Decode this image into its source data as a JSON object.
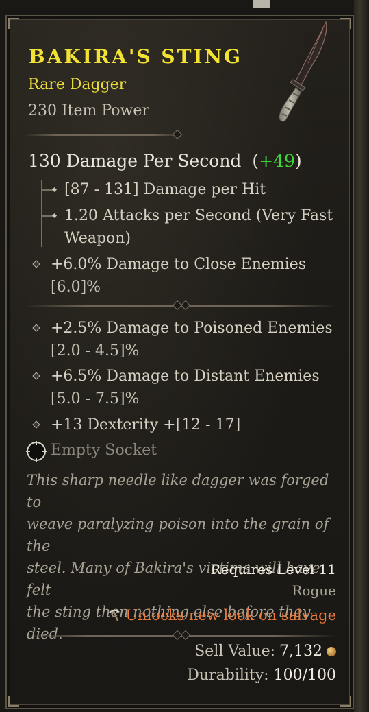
{
  "item": {
    "name": "BAKIRA'S STING",
    "rarity_type": "Rare Dagger",
    "item_power": "230 Item Power",
    "icon": "dagger-icon"
  },
  "damage": {
    "dps_label": "130 Damage Per Second",
    "dps_open": "(",
    "dps_bonus": "+49",
    "dps_close": ")",
    "per_hit": "[87 - 131] Damage per Hit",
    "attacks_line1": "1.20 Attacks per Second (Very Fast",
    "attacks_line2": "Weapon)"
  },
  "implicit": [
    {
      "line1": "+6.0% Damage to Close Enemies",
      "line2": "[6.0]%"
    }
  ],
  "affixes": [
    {
      "line1": "+2.5% Damage to Poisoned Enemies",
      "line2": "[2.0 - 4.5]%"
    },
    {
      "line1": "+6.5% Damage to Distant Enemies",
      "line2": "[5.0 - 7.5]%"
    },
    {
      "line1": "+13 Dexterity +[12 - 17]"
    }
  ],
  "socket": {
    "label": "Empty Socket",
    "icon": "socket-icon"
  },
  "flavor": {
    "line1": "This sharp needle like dagger was forged to",
    "line2": "weave paralyzing poison into the grain of the",
    "line3": "steel. Many of Bakira's victims will have felt",
    "line4": "the sting then nothing else before they died."
  },
  "requirements": {
    "level": "Requires Level 11",
    "class": "Rogue"
  },
  "salvage": {
    "text": "Unlocks new look on salvage",
    "icon": "pickaxe-icon"
  },
  "footer": {
    "sell_label": "Sell Value:",
    "sell_value": "7,132",
    "durability_label": "Durability:",
    "durability_value": "100/100"
  },
  "colors": {
    "title": "#f2e234",
    "rarity": "#e8da3a",
    "bonus": "#3fd43a",
    "salvage": "#e87a3c"
  }
}
